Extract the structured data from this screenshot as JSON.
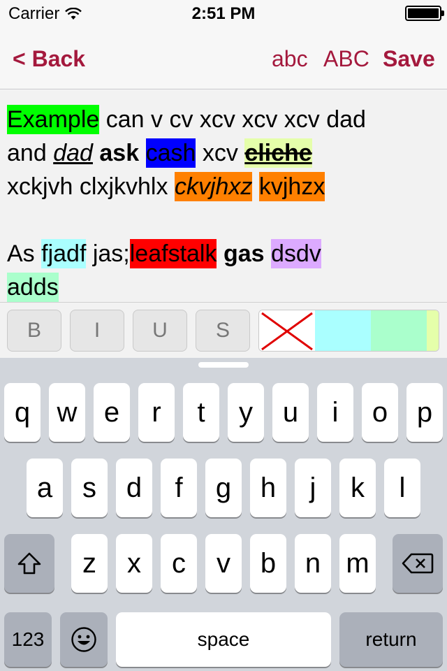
{
  "status_bar": {
    "carrier": "Carrier",
    "wifi_icon": "wifi-icon",
    "time": "2:51 PM",
    "battery_icon": "battery-icon"
  },
  "nav": {
    "back_label": "< Back",
    "lowercase_label": "abc",
    "uppercase_label": "ABC",
    "save_label": "Save"
  },
  "editor": {
    "line1": {
      "w_example": "Example",
      "t1": " can v cv xcv xcv xcv dad"
    },
    "line2": {
      "t_and": "and ",
      "w_dad": "dad",
      "w_ask": "ask",
      "w_cash": "cash",
      "t_xcv": " xcv ",
      "w_cliche": "cliche"
    },
    "line3": {
      "t_xck": "xckjvh clxjkvhlx ",
      "w_ckvjhxz": "ckvjhxz",
      "w_kvjhzx": "kvjhzx"
    },
    "line4": {
      "t_as": "As ",
      "w_fjadf": "fjadf",
      "t_jas": " jas;",
      "w_leafstalk": "leafstalk",
      "w_gas": "gas",
      "w_dsdv": "dsdv"
    },
    "line5": {
      "w_adds": "adds"
    }
  },
  "format_toolbar": {
    "bold_label": "B",
    "italic_label": "I",
    "underline_label": "U",
    "strike_label": "S",
    "swatch_colors": [
      "#ffffff",
      "#aaffff",
      "#aaffcc",
      "#e5ffaa"
    ]
  },
  "colors": {
    "accent": "#a4193d",
    "highlight_green": "#00ff00",
    "highlight_blue": "#0000ff",
    "highlight_lime": "#e5ffaa",
    "highlight_orange": "#ff8000",
    "highlight_cyan": "#aaffff",
    "highlight_red": "#ff0000",
    "highlight_purple": "#dcaaff",
    "highlight_mint": "#aaffcc"
  },
  "keyboard": {
    "row1": [
      "q",
      "w",
      "e",
      "r",
      "t",
      "y",
      "u",
      "i",
      "o",
      "p"
    ],
    "row2": [
      "a",
      "s",
      "d",
      "f",
      "g",
      "h",
      "j",
      "k",
      "l"
    ],
    "row3": [
      "z",
      "x",
      "c",
      "v",
      "b",
      "n",
      "m"
    ],
    "shift_icon": "shift-icon",
    "backspace_icon": "backspace-icon",
    "emoji_icon": "emoji-icon",
    "numbers_label": "123",
    "space_label": "space",
    "return_label": "return"
  }
}
